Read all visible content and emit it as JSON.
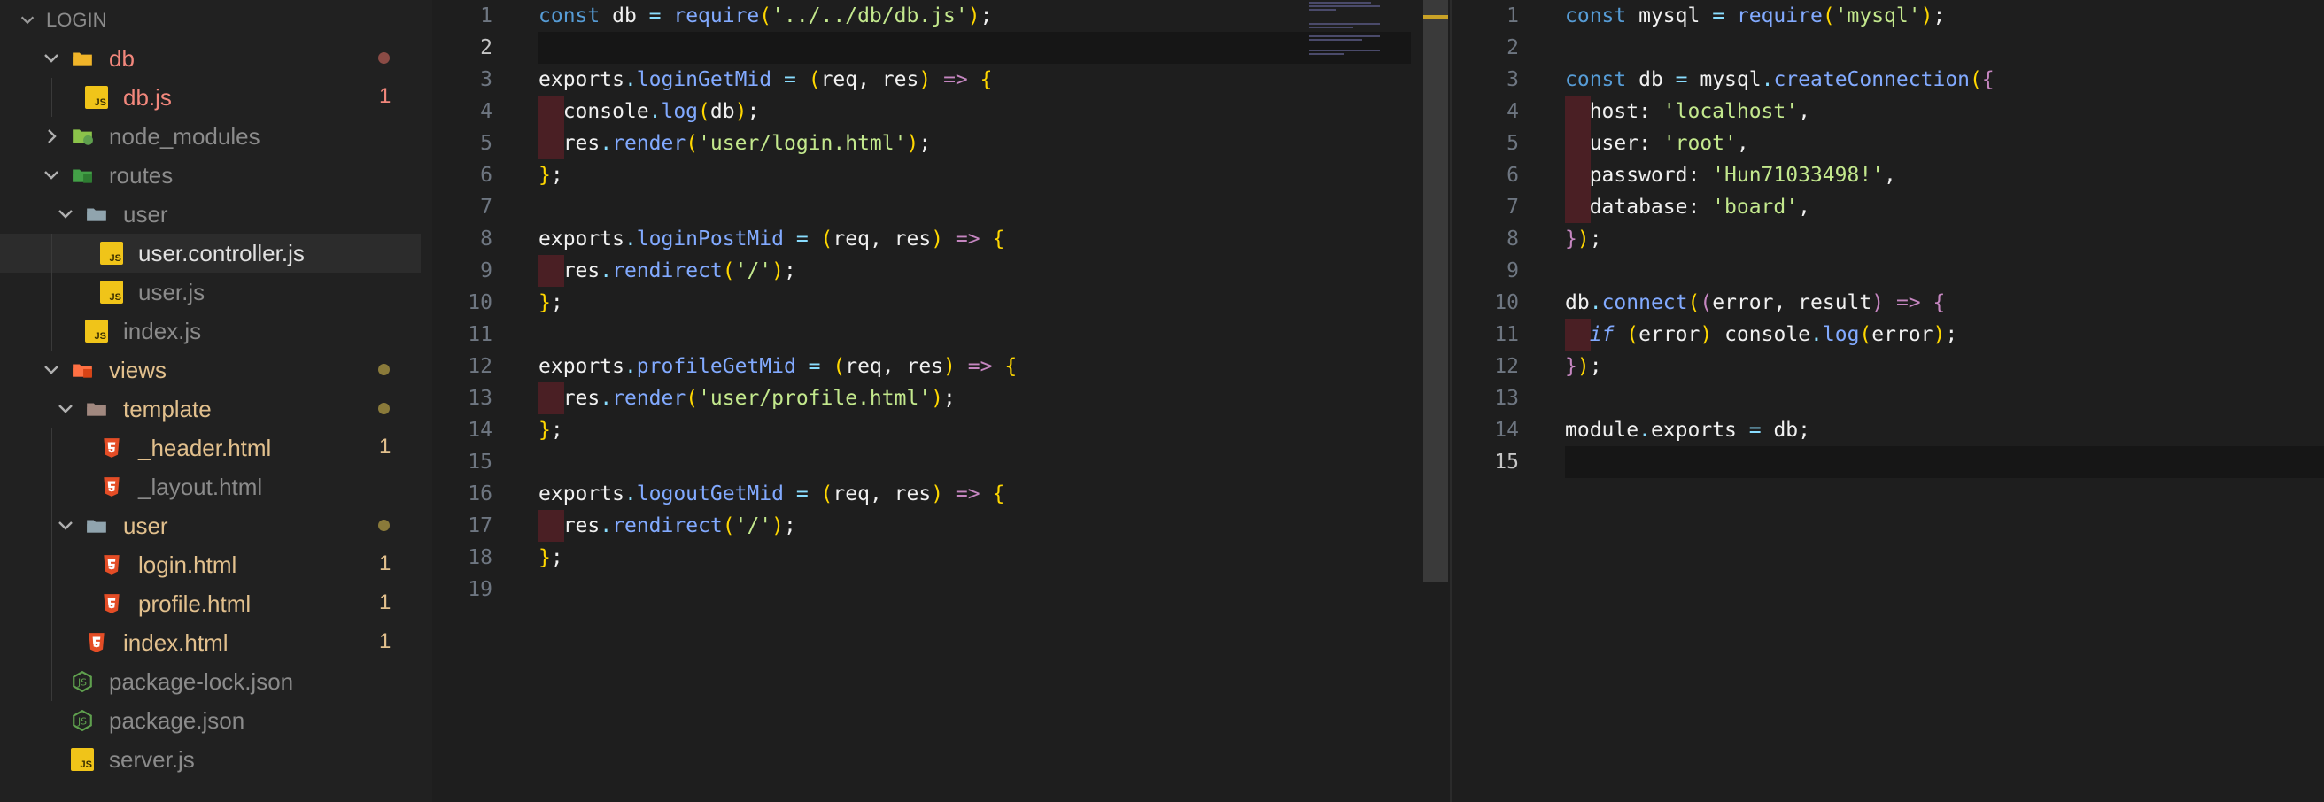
{
  "explorer": {
    "section_title": "LOGIN",
    "items": [
      {
        "label": "db",
        "type": "folder-open",
        "badge": "",
        "dot": "#8a4b45",
        "color": "#f2877c"
      },
      {
        "label": "db.js",
        "type": "js",
        "badge": "1",
        "dot": "",
        "color": "#f2877c"
      },
      {
        "label": "node_modules",
        "type": "folder-closed",
        "badge": "",
        "dot": "",
        "color": "#8b8b8b"
      },
      {
        "label": "routes",
        "type": "folder-open",
        "badge": "",
        "dot": "",
        "color": "#8b8b8b"
      },
      {
        "label": "user",
        "type": "folder-open",
        "badge": "",
        "dot": "",
        "color": "#8b8b8b"
      },
      {
        "label": "user.controller.js",
        "type": "js",
        "badge": "",
        "dot": "",
        "color": "#e0e0e0"
      },
      {
        "label": "user.js",
        "type": "js",
        "badge": "",
        "dot": "",
        "color": "#8b8b8b"
      },
      {
        "label": "index.js",
        "type": "js",
        "badge": "",
        "dot": "",
        "color": "#8b8b8b"
      },
      {
        "label": "views",
        "type": "folder-open",
        "badge": "",
        "dot": "#8a7a3a",
        "color": "#e2c08d"
      },
      {
        "label": "template",
        "type": "folder-open",
        "badge": "",
        "dot": "#8a7a3a",
        "color": "#e2c08d"
      },
      {
        "label": "_header.html",
        "type": "html",
        "badge": "1",
        "dot": "",
        "color": "#e2c08d"
      },
      {
        "label": "_layout.html",
        "type": "html",
        "badge": "",
        "dot": "",
        "color": "#8b8b8b"
      },
      {
        "label": "user",
        "type": "folder-open",
        "badge": "",
        "dot": "#8a7a3a",
        "color": "#e2c08d"
      },
      {
        "label": "login.html",
        "type": "html",
        "badge": "1",
        "dot": "",
        "color": "#e2c08d"
      },
      {
        "label": "profile.html",
        "type": "html",
        "badge": "1",
        "dot": "",
        "color": "#e2c08d"
      },
      {
        "label": "index.html",
        "type": "html",
        "badge": "1",
        "dot": "",
        "color": "#e2c08d"
      },
      {
        "label": "package-lock.json",
        "type": "json",
        "badge": "",
        "dot": "",
        "color": "#8b8b8b"
      },
      {
        "label": "package.json",
        "type": "json",
        "badge": "",
        "dot": "",
        "color": "#8b8b8b"
      },
      {
        "label": "server.js",
        "type": "js",
        "badge": "",
        "dot": "",
        "color": "#8b8b8b"
      }
    ]
  },
  "left_editor": {
    "active_line": 2,
    "lines": [
      [
        [
          "kb",
          "const"
        ],
        [
          "v",
          " db "
        ],
        [
          "p",
          "="
        ],
        [
          "f",
          " require"
        ],
        [
          "b",
          "("
        ],
        [
          "s",
          "'../../db/db.js'"
        ],
        [
          "b",
          ")"
        ],
        [
          "v",
          ";"
        ]
      ],
      [],
      [
        [
          "v",
          "exports"
        ],
        [
          "p",
          "."
        ],
        [
          "f",
          "loginGetMid"
        ],
        [
          "v",
          " "
        ],
        [
          "p",
          "="
        ],
        [
          "v",
          " "
        ],
        [
          "b",
          "("
        ],
        [
          "v",
          "req, res"
        ],
        [
          "b",
          ")"
        ],
        [
          "v",
          " "
        ],
        [
          "k",
          "=>"
        ],
        [
          "v",
          " "
        ],
        [
          "b",
          "{"
        ]
      ],
      [
        [
          "v",
          "  console"
        ],
        [
          "p",
          "."
        ],
        [
          "f",
          "log"
        ],
        [
          "b",
          "("
        ],
        [
          "v",
          "db"
        ],
        [
          "b",
          ")"
        ],
        [
          "v",
          ";"
        ]
      ],
      [
        [
          "v",
          "  res"
        ],
        [
          "p",
          "."
        ],
        [
          "f",
          "render"
        ],
        [
          "b",
          "("
        ],
        [
          "s",
          "'user/login.html'"
        ],
        [
          "b",
          ")"
        ],
        [
          "v",
          ";"
        ]
      ],
      [
        [
          "b",
          "}"
        ],
        [
          "v",
          ";"
        ]
      ],
      [],
      [
        [
          "v",
          "exports"
        ],
        [
          "p",
          "."
        ],
        [
          "f",
          "loginPostMid"
        ],
        [
          "v",
          " "
        ],
        [
          "p",
          "="
        ],
        [
          "v",
          " "
        ],
        [
          "b",
          "("
        ],
        [
          "v",
          "req, res"
        ],
        [
          "b",
          ")"
        ],
        [
          "v",
          " "
        ],
        [
          "k",
          "=>"
        ],
        [
          "v",
          " "
        ],
        [
          "b",
          "{"
        ]
      ],
      [
        [
          "v",
          "  res"
        ],
        [
          "p",
          "."
        ],
        [
          "f",
          "rendirect"
        ],
        [
          "b",
          "("
        ],
        [
          "s",
          "'/'"
        ],
        [
          "b",
          ")"
        ],
        [
          "v",
          ";"
        ]
      ],
      [
        [
          "b",
          "}"
        ],
        [
          "v",
          ";"
        ]
      ],
      [],
      [
        [
          "v",
          "exports"
        ],
        [
          "p",
          "."
        ],
        [
          "f",
          "profileGetMid"
        ],
        [
          "v",
          " "
        ],
        [
          "p",
          "="
        ],
        [
          "v",
          " "
        ],
        [
          "b",
          "("
        ],
        [
          "v",
          "req, res"
        ],
        [
          "b",
          ")"
        ],
        [
          "v",
          " "
        ],
        [
          "k",
          "=>"
        ],
        [
          "v",
          " "
        ],
        [
          "b",
          "{"
        ]
      ],
      [
        [
          "v",
          "  res"
        ],
        [
          "p",
          "."
        ],
        [
          "f",
          "render"
        ],
        [
          "b",
          "("
        ],
        [
          "s",
          "'user/profile.html'"
        ],
        [
          "b",
          ")"
        ],
        [
          "v",
          ";"
        ]
      ],
      [
        [
          "b",
          "}"
        ],
        [
          "v",
          ";"
        ]
      ],
      [],
      [
        [
          "v",
          "exports"
        ],
        [
          "p",
          "."
        ],
        [
          "f",
          "logoutGetMid"
        ],
        [
          "v",
          " "
        ],
        [
          "p",
          "="
        ],
        [
          "v",
          " "
        ],
        [
          "b",
          "("
        ],
        [
          "v",
          "req, res"
        ],
        [
          "b",
          ")"
        ],
        [
          "v",
          " "
        ],
        [
          "k",
          "=>"
        ],
        [
          "v",
          " "
        ],
        [
          "b",
          "{"
        ]
      ],
      [
        [
          "v",
          "  res"
        ],
        [
          "p",
          "."
        ],
        [
          "f",
          "rendirect"
        ],
        [
          "b",
          "("
        ],
        [
          "s",
          "'/'"
        ],
        [
          "b",
          ")"
        ],
        [
          "v",
          ";"
        ]
      ],
      [
        [
          "b",
          "}"
        ],
        [
          "v",
          ";"
        ]
      ],
      []
    ]
  },
  "right_editor": {
    "active_line": 15,
    "lines": [
      [
        [
          "kb",
          "const"
        ],
        [
          "v",
          " mysql "
        ],
        [
          "p",
          "="
        ],
        [
          "f",
          " require"
        ],
        [
          "b",
          "("
        ],
        [
          "s",
          "'mysql'"
        ],
        [
          "b",
          ")"
        ],
        [
          "v",
          ";"
        ]
      ],
      [],
      [
        [
          "kb",
          "const"
        ],
        [
          "v",
          " db "
        ],
        [
          "p",
          "="
        ],
        [
          "v",
          " mysql"
        ],
        [
          "p",
          "."
        ],
        [
          "f",
          "createConnection"
        ],
        [
          "b",
          "("
        ],
        [
          "k",
          "{"
        ]
      ],
      [
        [
          "v",
          "  host: "
        ],
        [
          "s",
          "'localhost'"
        ],
        [
          "v",
          ","
        ]
      ],
      [
        [
          "v",
          "  user: "
        ],
        [
          "s",
          "'root'"
        ],
        [
          "v",
          ","
        ]
      ],
      [
        [
          "v",
          "  password: "
        ],
        [
          "s",
          "'Hun71033498!'"
        ],
        [
          "v",
          ","
        ]
      ],
      [
        [
          "v",
          "  database: "
        ],
        [
          "s",
          "'board'"
        ],
        [
          "v",
          ","
        ]
      ],
      [
        [
          "k",
          "}"
        ],
        [
          "b",
          ")"
        ],
        [
          "v",
          ";"
        ]
      ],
      [],
      [
        [
          "v",
          "db"
        ],
        [
          "p",
          "."
        ],
        [
          "f",
          "connect"
        ],
        [
          "b",
          "("
        ],
        [
          "k",
          "("
        ],
        [
          "v",
          "error, result"
        ],
        [
          "k",
          ")"
        ],
        [
          "v",
          " "
        ],
        [
          "k",
          "=>"
        ],
        [
          "v",
          " "
        ],
        [
          "k",
          "{"
        ]
      ],
      [
        [
          "v",
          "  "
        ],
        [
          "it",
          "if"
        ],
        [
          "v",
          " "
        ],
        [
          "b",
          "("
        ],
        [
          "v",
          "error"
        ],
        [
          "b",
          ")"
        ],
        [
          "v",
          " console"
        ],
        [
          "p",
          "."
        ],
        [
          "f",
          "log"
        ],
        [
          "b",
          "("
        ],
        [
          "v",
          "error"
        ],
        [
          "b",
          ")"
        ],
        [
          "v",
          ";"
        ]
      ],
      [
        [
          "k",
          "}"
        ],
        [
          "b",
          ")"
        ],
        [
          "v",
          ";"
        ]
      ],
      [],
      [
        [
          "v",
          "module"
        ],
        [
          "p",
          "."
        ],
        [
          "v",
          "exports "
        ],
        [
          "p",
          "="
        ],
        [
          "v",
          " db;"
        ]
      ],
      []
    ]
  }
}
